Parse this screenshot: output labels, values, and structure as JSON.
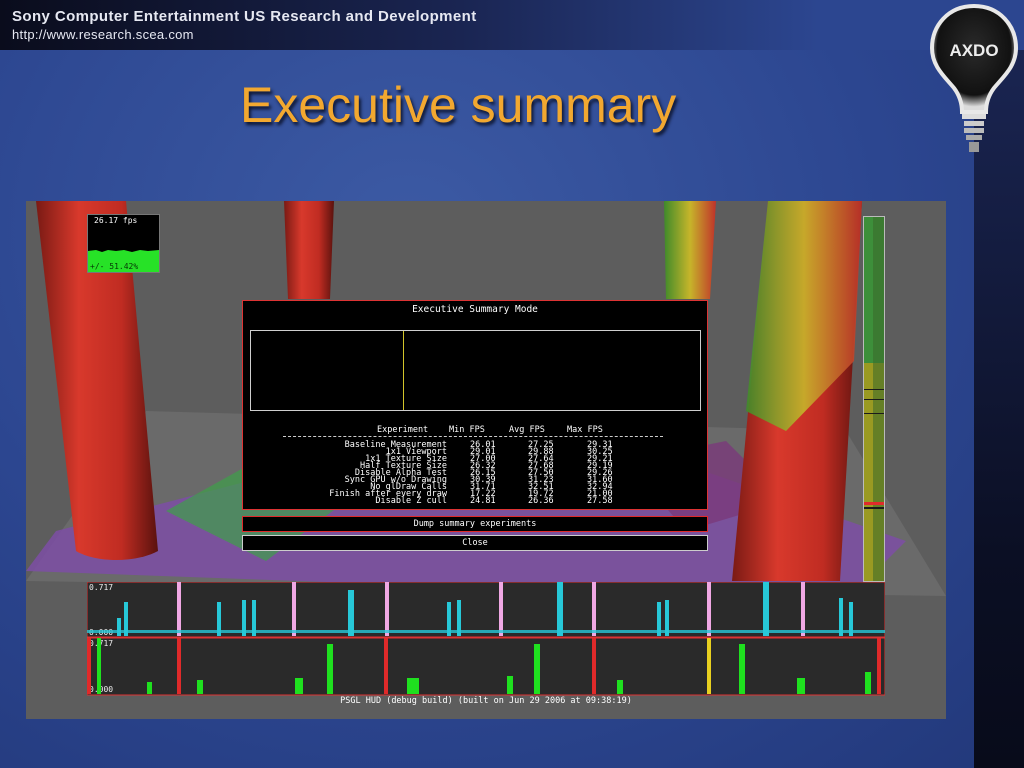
{
  "header": {
    "company": "Sony Computer Entertainment US Research and Development",
    "url": "http://www.research.scea.com",
    "logo_text": "AXDO"
  },
  "slide": {
    "title": "Executive summary"
  },
  "screenshot": {
    "fps_counter": {
      "value": "26.17 fps",
      "percent": "+/- 51.42%"
    },
    "dialog": {
      "title": "Executive Summary Mode",
      "columns": [
        "Experiment",
        "Min FPS",
        "Avg FPS",
        "Max FPS"
      ],
      "rows": [
        {
          "name": "Baseline Measurement",
          "min": "26.01",
          "avg": "27.25",
          "max": "29.31"
        },
        {
          "name": "1x1 Viewport",
          "min": "29.01",
          "avg": "29.88",
          "max": "30.25"
        },
        {
          "name": "1x1 Texture Size",
          "min": "27.00",
          "avg": "27.64",
          "max": "29.21"
        },
        {
          "name": "Half Texture Size",
          "min": "26.32",
          "avg": "27.68",
          "max": "29.19"
        },
        {
          "name": "Disable Alpha Test",
          "min": "26.15",
          "avg": "27.50",
          "max": "29.26"
        },
        {
          "name": "Sync GPU w/o Drawing",
          "min": "30.39",
          "avg": "31.23",
          "max": "31.60"
        },
        {
          "name": "No glDraw Calls",
          "min": "31.71",
          "avg": "32.51",
          "max": "32.94"
        },
        {
          "name": "Finish after every draw",
          "min": "17.22",
          "avg": "19.72",
          "max": "21.00"
        },
        {
          "name": "Disable Z cull",
          "min": "24.81",
          "avg": "26.36",
          "max": "27.58"
        }
      ],
      "dump_button": "Dump summary experiments",
      "close_button": "Close"
    },
    "graphs": {
      "top": {
        "max_label": "0.717",
        "min_label": "0.000"
      },
      "bottom": {
        "max_label": "0.717",
        "min_label": "0.000"
      }
    },
    "status": "PSGL HUD (debug build) (built on Jun 29 2006 at 09:38:19)"
  },
  "colors": {
    "title": "#f2a830",
    "accent_red": "#e02a2a",
    "bar_green": "#1fe01f",
    "bar_cyan": "#27c8d8",
    "bar_pink": "#f0a8e4",
    "bar_yellow": "#e8d020"
  }
}
